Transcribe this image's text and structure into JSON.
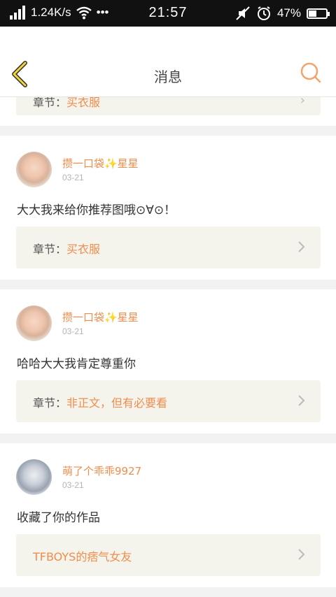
{
  "status": {
    "speed": "1.24K/s",
    "dots": "•••",
    "time": "21:57",
    "battery": "47%",
    "battery_level": 0.47
  },
  "header": {
    "title": "消息"
  },
  "prev": {
    "chapter_label": "章节：",
    "chapter_value": "买衣服"
  },
  "messages": [
    {
      "user": "攒一口袋✨星星",
      "date": "03-21",
      "text": "大大我来给你推荐图哦⊙∀⊙！",
      "chip_label": "章节：",
      "chip_value": "买衣服"
    },
    {
      "user": "攒一口袋✨星星",
      "date": "03-21",
      "text": "哈哈大大我肯定尊重你",
      "chip_label": "章节：",
      "chip_value": "非正文，但有必要看"
    },
    {
      "user": "萌了个乖乖9927",
      "date": "03-21",
      "text": "收藏了你的作品",
      "chip_label": "",
      "chip_value": "TFBOYS的痞气女友"
    }
  ],
  "colors": {
    "accent": "#f08d4b",
    "back_arrow": "#f5d33a",
    "chip_bg": "#f4f3ec"
  }
}
